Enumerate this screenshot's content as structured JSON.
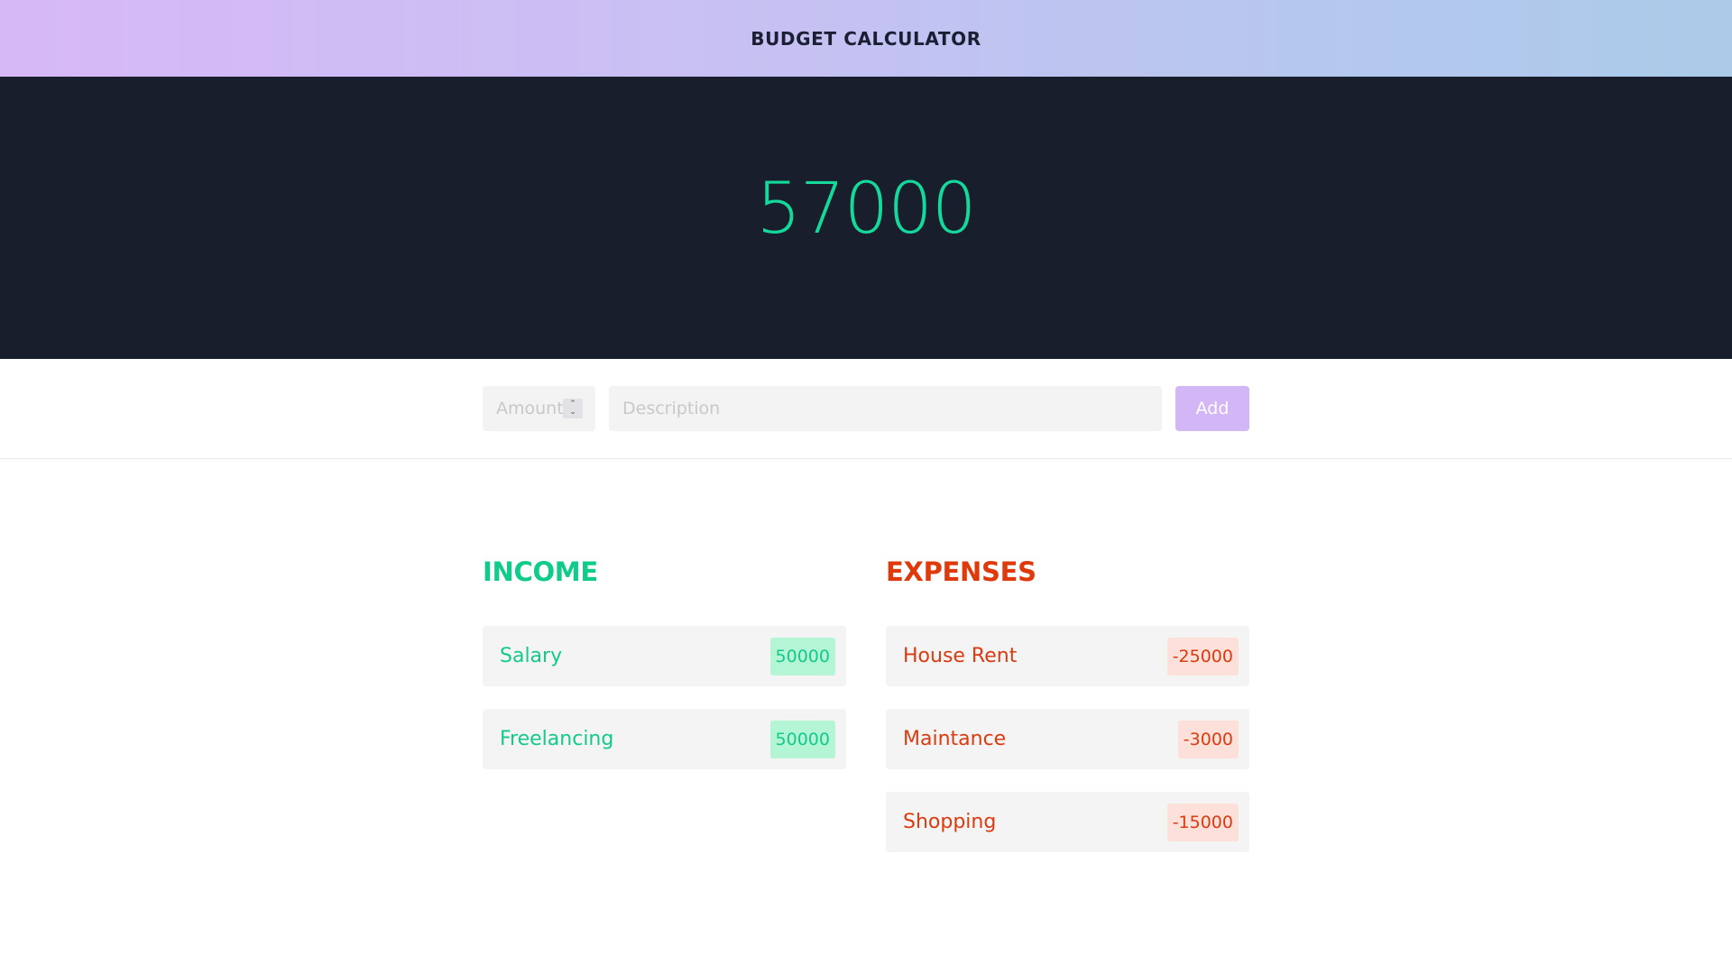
{
  "header": {
    "title": "BUDGET CALCULATOR"
  },
  "balance": {
    "value": "57000",
    "color": "#14d99a"
  },
  "form": {
    "amount_placeholder": "Amount",
    "description_placeholder": "Description",
    "add_label": "Add",
    "add_color": "#d3b6f5"
  },
  "income": {
    "title": "INCOME",
    "color": "#0fcc8a",
    "items": [
      {
        "label": "Salary",
        "value": "50000"
      },
      {
        "label": "Freelancing",
        "value": "50000"
      }
    ]
  },
  "expenses": {
    "title": "EXPENSES",
    "color": "#de3a0b",
    "items": [
      {
        "label": "House Rent",
        "value": "-25000"
      },
      {
        "label": "Maintance",
        "value": "-3000"
      },
      {
        "label": "Shopping",
        "value": "-15000"
      }
    ]
  }
}
